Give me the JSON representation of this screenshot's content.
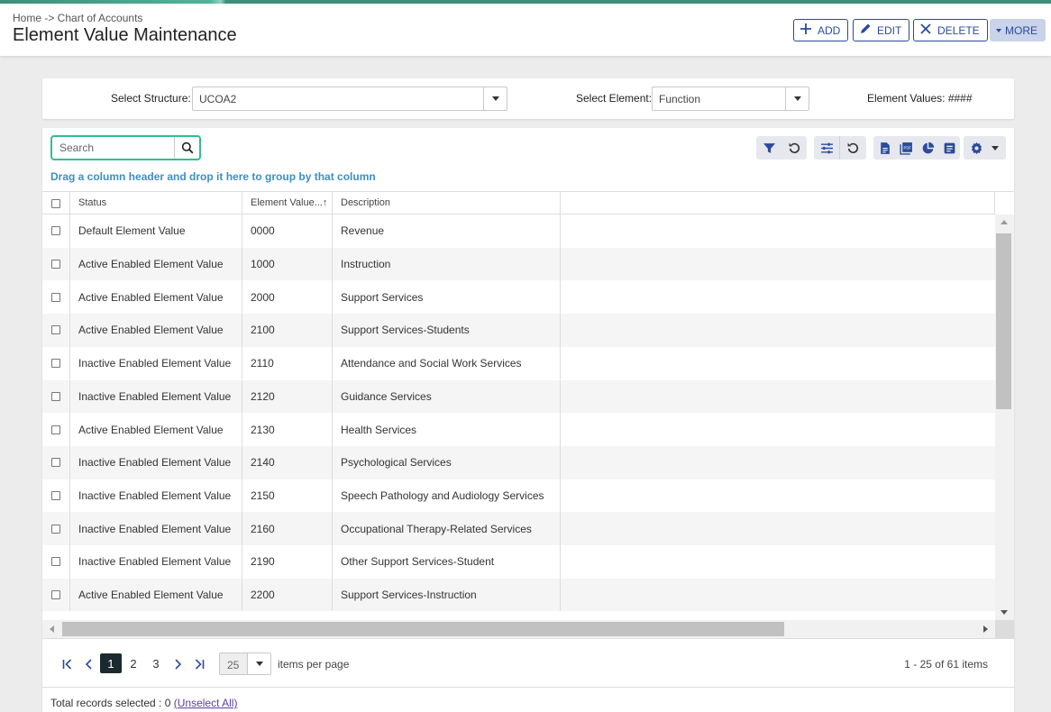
{
  "colors": {
    "accent": "#3d8f7a",
    "primary": "#2a4b9e",
    "search_focus": "#2fbf8f",
    "hint": "#3b8fc6",
    "pager_active": "#1b2a2e"
  },
  "header": {
    "breadcrumb": "Home -> Chart of Accounts",
    "title": "Element Value Maintenance",
    "buttons": {
      "add": "ADD",
      "edit": "EDIT",
      "delete": "DELETE",
      "more": "MORE"
    }
  },
  "filters": {
    "structure_label": "Select Structure:",
    "structure_value": "UCOA2",
    "element_label": "Select Element:",
    "element_value": "Function",
    "element_values_text": "Element Values: ####"
  },
  "grid": {
    "search_placeholder": "Search",
    "group_hint": "Drag a column header and drop it here to group by that column",
    "toolbar_icons": [
      "filter-icon",
      "reset-icon",
      "column-settings-icon",
      "reset-icon",
      "excel-export-icon",
      "pdf-export-icon",
      "chart-icon",
      "report-icon",
      "gear-icon"
    ],
    "columns": [
      "Status",
      "Element Value...↑",
      "Description"
    ],
    "rows": [
      {
        "status": "Default Element Value",
        "value": "0000",
        "description": "Revenue"
      },
      {
        "status": "Active Enabled Element Value",
        "value": "1000",
        "description": "Instruction"
      },
      {
        "status": "Active Enabled Element Value",
        "value": "2000",
        "description": "Support Services"
      },
      {
        "status": "Active Enabled Element Value",
        "value": "2100",
        "description": "Support Services-Students"
      },
      {
        "status": "Inactive Enabled Element Value",
        "value": "2110",
        "description": "Attendance and Social Work Services"
      },
      {
        "status": "Inactive Enabled Element Value",
        "value": "2120",
        "description": "Guidance Services"
      },
      {
        "status": "Active Enabled Element Value",
        "value": "2130",
        "description": "Health Services"
      },
      {
        "status": "Inactive Enabled Element Value",
        "value": "2140",
        "description": "Psychological Services"
      },
      {
        "status": "Inactive Enabled Element Value",
        "value": "2150",
        "description": "Speech Pathology and Audiology Services"
      },
      {
        "status": "Inactive Enabled Element Value",
        "value": "2160",
        "description": "Occupational Therapy-Related Services"
      },
      {
        "status": "Inactive Enabled Element Value",
        "value": "2190",
        "description": "Other Support Services-Student"
      },
      {
        "status": "Active Enabled Element Value",
        "value": "2200",
        "description": "Support Services-Instruction"
      }
    ]
  },
  "pager": {
    "pages": [
      "1",
      "2",
      "3"
    ],
    "current_page": "1",
    "page_size": "25",
    "items_per_page_label": "items per page",
    "info": "1 - 25 of 61 items"
  },
  "footer": {
    "selected_text": "Total records selected : 0",
    "unselect_link": "(Unselect All)"
  }
}
